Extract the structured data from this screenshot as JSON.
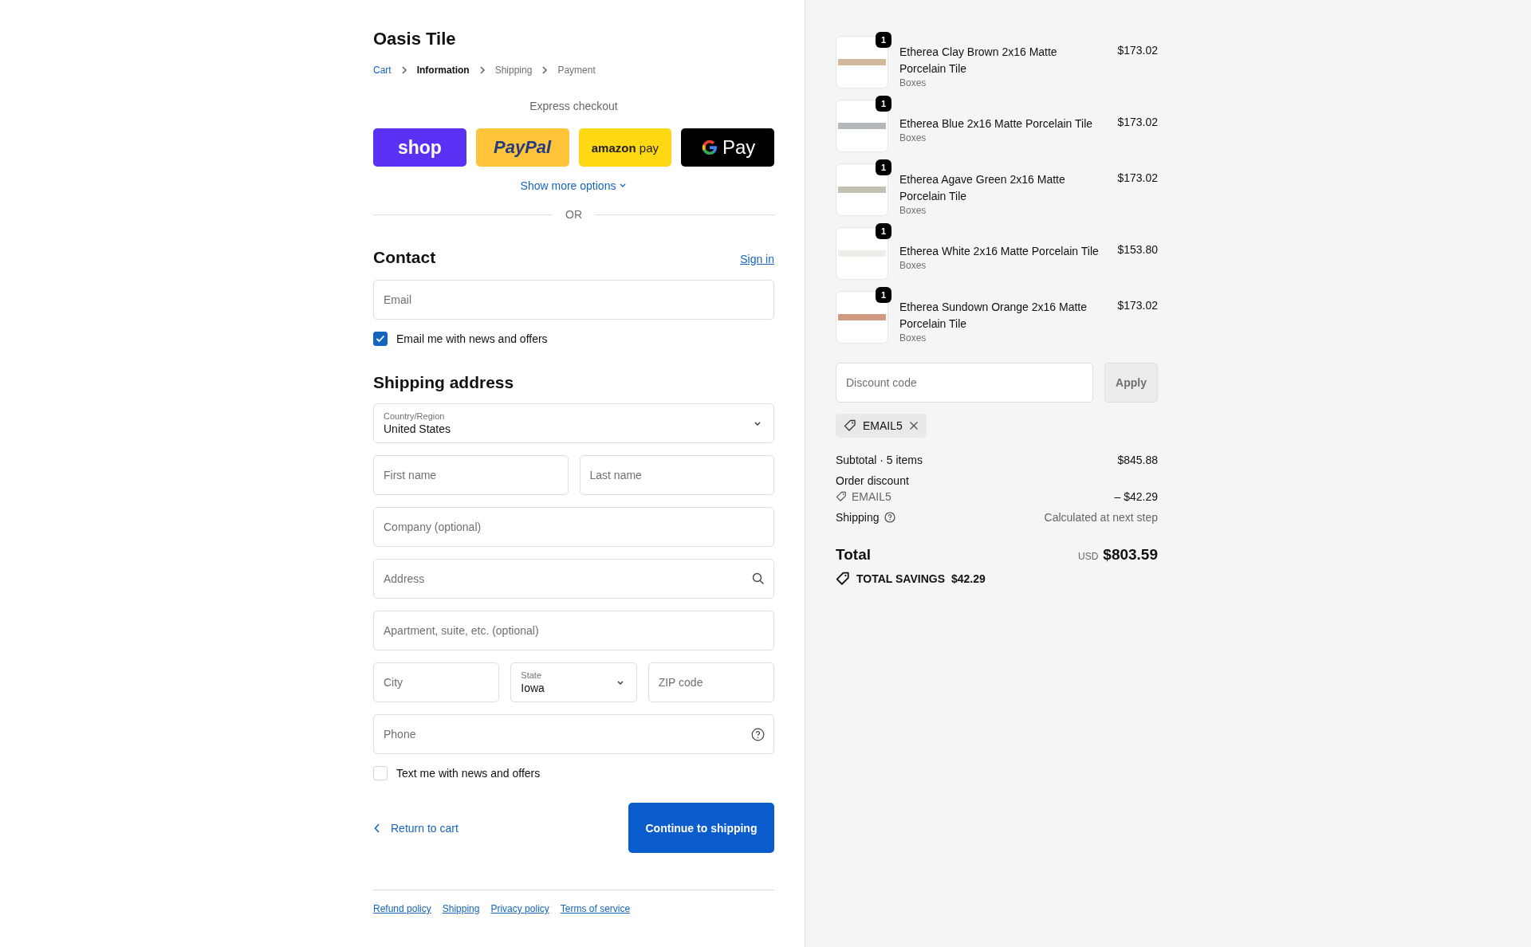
{
  "store": {
    "name": "Oasis Tile"
  },
  "breadcrumbs": [
    {
      "label": "Cart",
      "kind": "link"
    },
    {
      "label": "Information",
      "kind": "current"
    },
    {
      "label": "Shipping",
      "kind": "pending"
    },
    {
      "label": "Payment",
      "kind": "pending"
    }
  ],
  "express_checkout": {
    "title": "Express checkout",
    "wallets": [
      {
        "kind": "shop",
        "label": "shop"
      },
      {
        "kind": "paypal",
        "label": "PayPal"
      },
      {
        "kind": "amazon",
        "label": "**amazon** pay"
      },
      {
        "kind": "gpay",
        "label": "Pay"
      }
    ],
    "more": "Show more options",
    "divider": "OR"
  },
  "contact": {
    "title": "Contact",
    "sign_in": "Sign in",
    "email": {
      "placeholder": "Email"
    },
    "newsletter": {
      "label": "Email me with news and offers",
      "checked": true
    }
  },
  "shipping_address": {
    "title": "Shipping address",
    "rows": [
      [
        {
          "kind": "select",
          "label": "Country/Region",
          "value": "United States"
        }
      ],
      [
        {
          "kind": "text",
          "placeholder": "First name"
        },
        {
          "kind": "text",
          "placeholder": "Last name"
        }
      ],
      [
        {
          "kind": "text",
          "placeholder": "Company (optional)"
        }
      ],
      [
        {
          "kind": "search",
          "placeholder": "Address"
        }
      ],
      [
        {
          "kind": "text",
          "placeholder": "Apartment, suite, etc. (optional)"
        }
      ],
      [
        {
          "kind": "text",
          "placeholder": "City"
        },
        {
          "kind": "select",
          "label": "State",
          "value": "Iowa"
        },
        {
          "kind": "text",
          "placeholder": "ZIP code"
        }
      ],
      [
        {
          "kind": "help",
          "placeholder": "Phone"
        }
      ]
    ],
    "sms": {
      "label": "Text me with news and offers",
      "checked": false
    }
  },
  "actions": {
    "back": "Return to cart",
    "continue": "Continue to shipping"
  },
  "footer_links": [
    "Refund policy",
    "Shipping",
    "Privacy policy",
    "Terms of service"
  ],
  "order_summary": {
    "items": [
      {
        "name": "Etherea Clay Brown 2x16 Matte Porcelain Tile",
        "variant": "Boxes",
        "price": "$173.02",
        "quantity": "1",
        "color": "#d2b89a"
      },
      {
        "name": "Etherea Blue 2x16 Matte Porcelain Tile",
        "variant": "Boxes",
        "price": "$173.02",
        "quantity": "1",
        "color": "#b3b8bc"
      },
      {
        "name": "Etherea Agave Green 2x16 Matte Porcelain Tile",
        "variant": "Boxes",
        "price": "$173.02",
        "quantity": "1",
        "color": "#c2c1b2"
      },
      {
        "name": "Etherea White 2x16 Matte Porcelain Tile",
        "variant": "Boxes",
        "price": "$153.80",
        "quantity": "1",
        "color": "#eeede7"
      },
      {
        "name": "Etherea Sundown Orange 2x16 Matte Porcelain Tile",
        "variant": "Boxes",
        "price": "$173.02",
        "quantity": "1",
        "color": "#cf9a80"
      }
    ],
    "discount": {
      "placeholder": "Discount code",
      "button": "Apply"
    },
    "applied_code": "EMAIL5",
    "lines": [
      {
        "kind": "plain",
        "label": "Subtotal · 5 items",
        "value": "$845.88"
      },
      {
        "kind": "heading",
        "label": "Order discount"
      },
      {
        "kind": "discount",
        "label": "EMAIL5",
        "value": "– $42.29"
      },
      {
        "kind": "help",
        "label": "Shipping",
        "value": "Calculated at next step"
      }
    ],
    "total": {
      "label": "Total",
      "currency": "USD",
      "amount": "$803.59"
    },
    "savings": {
      "label": "TOTAL SAVINGS",
      "amount": "$42.29"
    }
  }
}
